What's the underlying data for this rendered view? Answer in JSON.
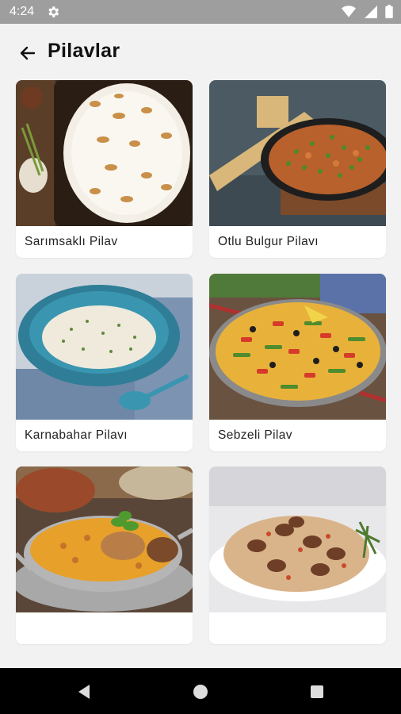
{
  "status_bar": {
    "time": "4:24",
    "icons": [
      "gear-icon",
      "wifi-icon",
      "signal-icon",
      "battery-icon"
    ]
  },
  "header": {
    "title": "Pilavlar",
    "back_icon": "arrow-left-icon"
  },
  "recipes": [
    {
      "label": "Sarımsaklı Pilav"
    },
    {
      "label": "Otlu Bulgur Pilavı"
    },
    {
      "label": "Karnabahar Pilavı"
    },
    {
      "label": "Sebzeli Pilav"
    },
    {
      "label": ""
    },
    {
      "label": ""
    }
  ],
  "nav": {
    "icons": [
      "back-triangle-icon",
      "home-circle-icon",
      "recents-square-icon"
    ]
  },
  "colors": {
    "status_bar": "#9e9e9e",
    "background": "#f2f2f2",
    "nav_bar": "#000000"
  }
}
